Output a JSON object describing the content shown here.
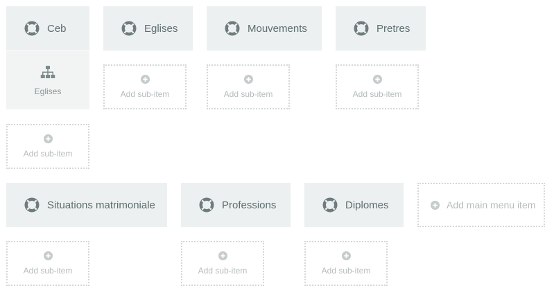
{
  "menu": {
    "row1": [
      {
        "label": "Ceb",
        "icon": "life-ring-icon",
        "sub_items": [
          {
            "label": "Eglises",
            "icon": "sitemap-icon"
          }
        ],
        "add_sub_label": "Add sub-item"
      },
      {
        "label": "Eglises",
        "icon": "life-ring-icon",
        "add_sub_label": "Add sub-item"
      },
      {
        "label": "Mouvements",
        "icon": "life-ring-icon",
        "add_sub_label": "Add sub-item"
      },
      {
        "label": "Pretres",
        "icon": "life-ring-icon",
        "add_sub_label": "Add sub-item"
      }
    ],
    "row2": [
      {
        "label": "Situations matrimoniale",
        "icon": "life-ring-icon",
        "add_sub_label": "Add sub-item"
      },
      {
        "label": "Professions",
        "icon": "life-ring-icon",
        "add_sub_label": "Add sub-item"
      },
      {
        "label": "Diplomes",
        "icon": "life-ring-icon",
        "add_sub_label": "Add sub-item"
      }
    ],
    "add_main_label": "Add main menu item"
  },
  "colors": {
    "item_bg": "#ecf0f1",
    "item_text": "#5d6d6e",
    "icon": "#6f7b7c",
    "placeholder_border": "#d3d7d8",
    "placeholder_text": "#b5bcbd"
  }
}
